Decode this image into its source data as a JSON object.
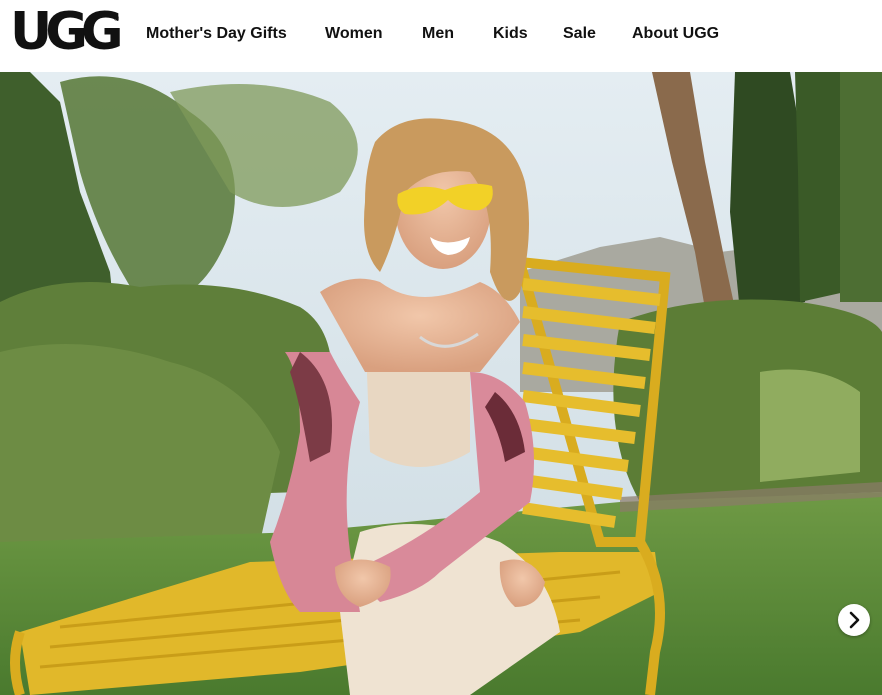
{
  "brand": {
    "logo_text": "UGG",
    "registered_mark": "®"
  },
  "nav": {
    "items": [
      {
        "label": "Mother's Day Gifts"
      },
      {
        "label": "Women"
      },
      {
        "label": "Men"
      },
      {
        "label": "Kids"
      },
      {
        "label": "Sale"
      },
      {
        "label": "About UGG"
      }
    ]
  },
  "hero": {
    "image_subject": "smiling woman in yellow sunglasses and pink denim jacket lounging on a yellow chaise lounge in a garden",
    "next_control_icon": "chevron-right-icon"
  },
  "colors": {
    "text": "#111111",
    "header_bg": "#ffffff",
    "chair_yellow": "#e3b82a",
    "jacket_pink": "#d98a9a",
    "lawn_green": "#5f8d3c",
    "sky": "#cfe0ea"
  }
}
